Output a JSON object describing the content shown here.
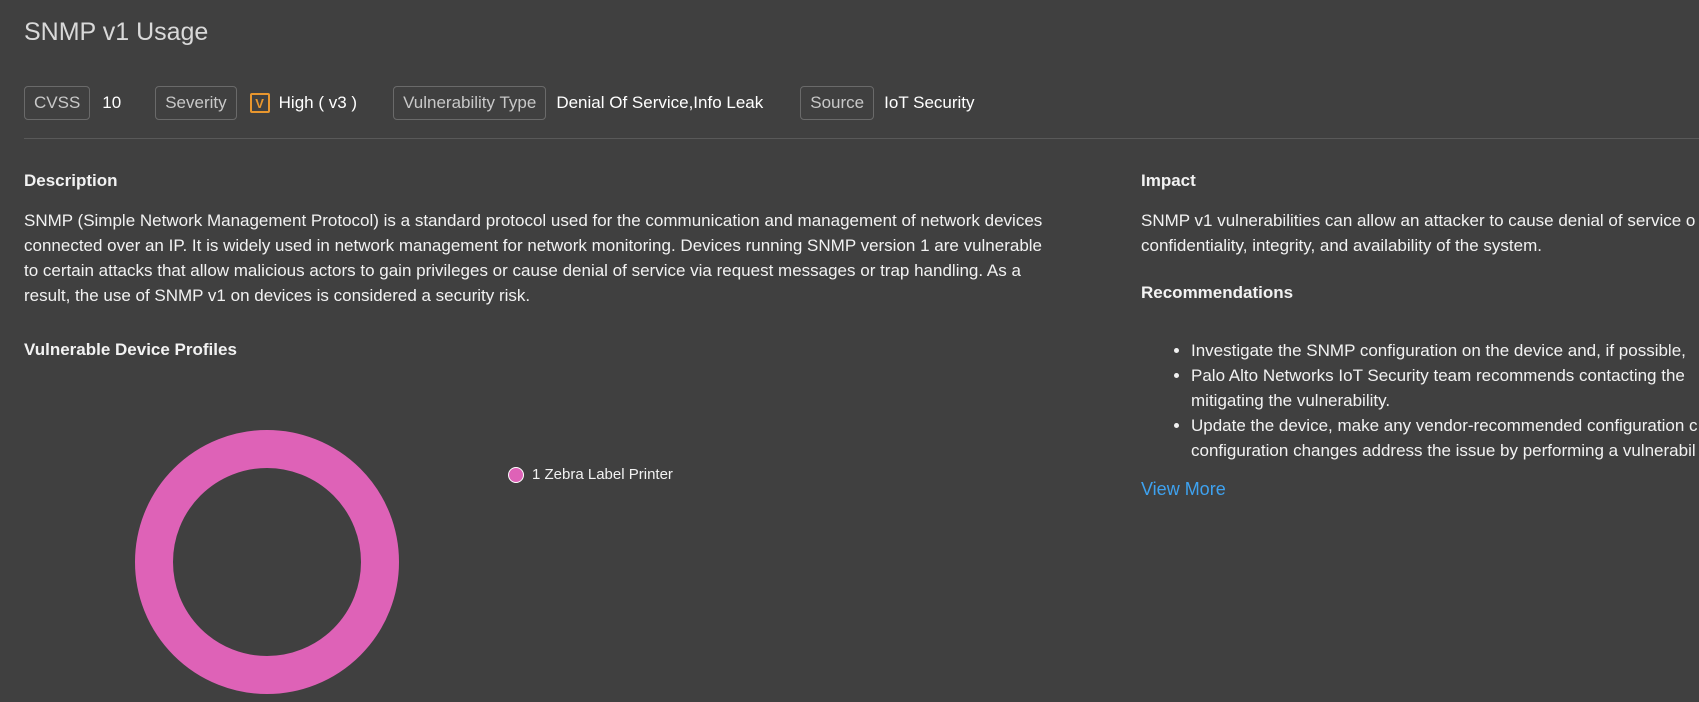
{
  "page": {
    "title": "SNMP v1 Usage"
  },
  "meta": {
    "cvss_label": "CVSS",
    "cvss_value": "10",
    "severity_label": "Severity",
    "severity_icon": "V",
    "severity_value": "High ( v3 )",
    "severity_color": "#e8962e",
    "vuln_type_label": "Vulnerability Type",
    "vuln_type_value": "Denial Of Service,Info Leak",
    "source_label": "Source",
    "source_value": "IoT Security"
  },
  "description": {
    "heading": "Description",
    "text": "SNMP (Simple Network Management Protocol) is a standard protocol used for the communication and management of network devices connected over an IP. It is widely used in network management for network monitoring. Devices running SNMP version 1 are vulnerable to certain attacks that allow malicious actors to gain privileges or cause denial of service via request messages or trap handling. As a result, the use of SNMP v1 on devices is considered a security risk."
  },
  "profiles": {
    "heading": "Vulnerable Device Profiles"
  },
  "impact": {
    "heading": "Impact",
    "line1": "SNMP v1 vulnerabilities can allow an attacker to cause denial of service o",
    "line2": "confidentiality, integrity, and availability of the system."
  },
  "recommendations": {
    "heading": "Recommendations",
    "items": [
      "Investigate the SNMP configuration on the device and, if possible,",
      "Palo Alto Networks IoT Security team recommends contacting the",
      "mitigating the vulnerability.",
      "Update the device, make any vendor-recommended configuration c",
      "configuration changes address the issue by performing a vulnerabil"
    ],
    "view_more": "View More",
    "link_color": "#3ea2f0"
  },
  "chart_data": {
    "type": "pie",
    "categories": [
      "Zebra Label Printer"
    ],
    "values": [
      1
    ],
    "legend_labels": [
      "1 Zebra Label Printer"
    ],
    "colors": [
      "#de62b7"
    ],
    "legend_position": "right"
  }
}
